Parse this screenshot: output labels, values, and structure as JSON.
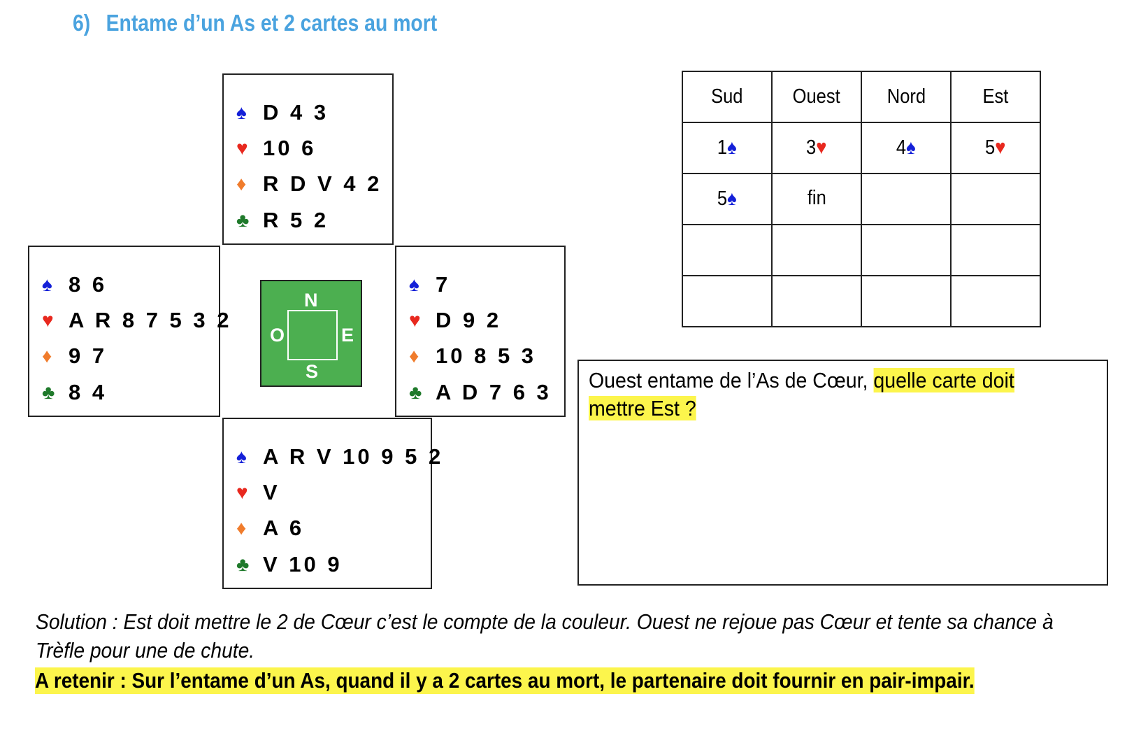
{
  "title": {
    "number": "6)",
    "text": "Entame d’un As et 2 cartes au mort"
  },
  "suits": {
    "spade_symbol": "♠",
    "heart_symbol": "♥",
    "diamond_symbol": "♦",
    "club_symbol": "♣",
    "colors": {
      "spade": "#1420d8",
      "heart": "#e8281e",
      "diamond": "#f07c2c",
      "club": "#1f7a2b"
    }
  },
  "hands": {
    "north": {
      "spades": "D 4 3",
      "hearts": "10 6",
      "diamonds": "R D V 4 2",
      "clubs": "R 5 2"
    },
    "west": {
      "spades": "8 6",
      "hearts": "A R 8 7 5 3 2",
      "diamonds": "9 7",
      "clubs": "8 4"
    },
    "east": {
      "spades": "7",
      "hearts": "D 9 2",
      "diamonds": "10 8 5 3",
      "clubs": "A D 7 6 3"
    },
    "south": {
      "spades": "A R V 10 9 5 2",
      "hearts": "V",
      "diamonds": "A 6",
      "clubs": "V 10 9"
    }
  },
  "compass": {
    "n": "N",
    "s": "S",
    "e": "E",
    "o": "O",
    "color": "#4caf50"
  },
  "bidding": {
    "headers": [
      "Sud",
      "Ouest",
      "Nord",
      "Est"
    ],
    "row1": [
      {
        "level": "1",
        "suit": "♠"
      },
      {
        "level": "3",
        "suit": "♥"
      },
      {
        "level": "4",
        "suit": "♠"
      },
      {
        "level": "5",
        "suit": "♥"
      }
    ],
    "row2": [
      {
        "level": "5",
        "suit": "♠"
      }
    ],
    "fin": "fin"
  },
  "question": {
    "text": "Ouest entame de l’As de Cœur, ",
    "highlight": "quelle carte doit mettre Est ?"
  },
  "solution": "Solution : Est doit mettre le 2 de Cœur c’est le compte de la couleur. Ouest ne rejoue pas Cœur et tente sa chance à Trèfle pour une de chute.",
  "retenir": "A retenir : Sur l’entame d’un As, quand il y a 2 cartes au mort, le partenaire doit fournir en pair-impair.",
  "highlight_color": "#fcf54c",
  "title_color": "#4aa3df"
}
